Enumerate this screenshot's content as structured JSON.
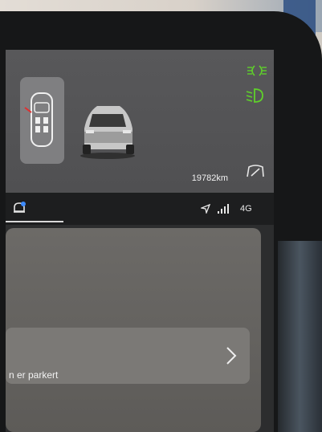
{
  "status": {
    "odometer": "19782km",
    "indicator_color": "#5fd12a"
  },
  "tabbar": {
    "network": "4G"
  },
  "card": {
    "row_label": "n er parkert"
  }
}
